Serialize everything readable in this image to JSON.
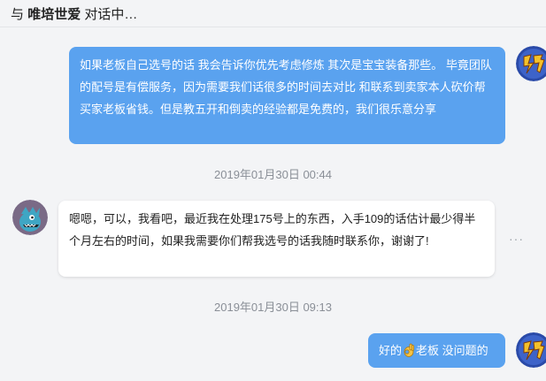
{
  "header": {
    "prefix": "与",
    "contact_name": "唯培世爱",
    "status": "对话中…"
  },
  "messages": [
    {
      "id": "msg-1",
      "sender": "me",
      "text": "如果老板自己选号的话 我会告诉你优先考虑修炼 其次是宝宝装备那些。 毕竟团队的配号是有偿服务，因为需要我们话很多的时间去对比 和联系到卖家本人砍价帮买家老板省钱。但是教五开和倒卖的经验都是免费的，我们很乐意分享"
    },
    {
      "id": "ts-1",
      "timestamp": "2019年01月30日 00:44"
    },
    {
      "id": "msg-2",
      "sender": "other",
      "text": "嗯嗯，可以，我看吧，最近我在处理175号上的东西，入手109的话估计最少得半个月左右的时间，如果我需要你们帮我选号的话我随时联系你，谢谢了!"
    },
    {
      "id": "ts-2",
      "timestamp": "2019年01月30日 09:13"
    },
    {
      "id": "msg-3",
      "sender": "me",
      "text_before": "好的",
      "emoji": "ok-hand-emoji",
      "text_after": "老板 没问题的"
    }
  ],
  "more_options_label": "···",
  "icons": {
    "my_avatar": "dream-logo-avatar",
    "other_avatar": "monster-avatar"
  },
  "colors": {
    "my_bubble": "#5aa2ef",
    "other_bubble": "#ffffff",
    "timestamp": "#8a8f97"
  }
}
